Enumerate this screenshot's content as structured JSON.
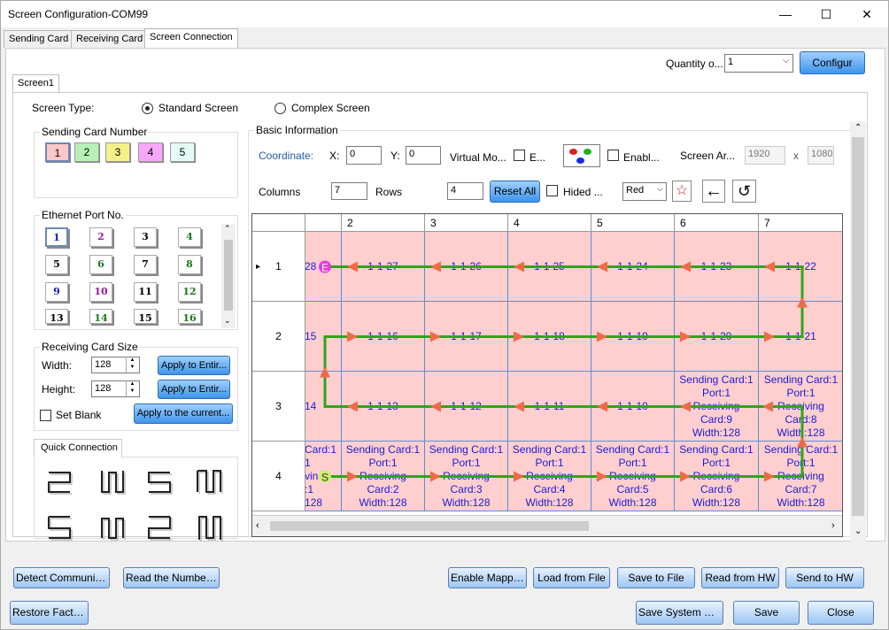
{
  "window": {
    "title": "Screen Configuration-COM99",
    "minimize": "—",
    "maximize": "☐",
    "close": "✕"
  },
  "tabs": [
    "Sending Card",
    "Receiving Card",
    "Screen Connection"
  ],
  "quantity": {
    "label": "Quantity o...",
    "value": "1",
    "configure": "Configur"
  },
  "screen_tab": "Screen1",
  "screen_type": {
    "label": "Screen Type:",
    "standard": "Standard Screen",
    "complex": "Complex Screen"
  },
  "sending_card_number": {
    "label": "Sending Card Number",
    "cards": [
      "1",
      "2",
      "3",
      "4",
      "5"
    ],
    "colors": [
      "#ffc8c8",
      "#b8f0b8",
      "#f6f08a",
      "#f8a8f8",
      "#e6fbf6"
    ]
  },
  "ethernet": {
    "label": "Ethernet Port No.",
    "ports": [
      "1",
      "2",
      "3",
      "4",
      "5",
      "6",
      "7",
      "8",
      "9",
      "10",
      "11",
      "12",
      "13",
      "14",
      "15",
      "16"
    ],
    "colors": [
      "#1a1ab8",
      "#9a1a9a",
      "#000000",
      "#1a7a1a",
      "#000000",
      "#1a7a1a",
      "#000000",
      "#1a7a1a",
      "#1a1ab8",
      "#9a1a9a",
      "#000000",
      "#1a7a1a",
      "#000000",
      "#1a7a1a",
      "#000000",
      "#1a7a1a"
    ]
  },
  "receiving_size": {
    "label": "Receiving Card Size",
    "width_label": "Width:",
    "width": "128",
    "height_label": "Height:",
    "height": "128",
    "apply_entire_w": "Apply to Entir...",
    "apply_entire_h": "Apply to Entir...",
    "set_blank": "Set Blank",
    "apply_current": "Apply to the current..."
  },
  "quick_connection": {
    "label": "Quick Connection"
  },
  "basic_info": {
    "label": "Basic Information",
    "coordinate": "Coordinate:",
    "x_label": "X:",
    "x": "0",
    "y_label": "Y:",
    "y": "0",
    "virtual_mode": "Virtual Mo...",
    "e_label": "E...",
    "enable_label": "Enabl...",
    "screen_area": "Screen Ar...",
    "area_w": "1920",
    "area_x": "x",
    "area_h": "1080",
    "columns_label": "Columns",
    "columns": "7",
    "rows_label": "Rows",
    "rows": "4",
    "reset_all": "Reset All",
    "hided": "Hided ...",
    "color": "Red"
  },
  "grid": {
    "col_headers": [
      "",
      "2",
      "3",
      "4",
      "5",
      "6",
      "7"
    ],
    "row_headers": [
      "1",
      "2",
      "3",
      "4"
    ],
    "rows": [
      [
        "28",
        "1-1-27",
        "1-1-26",
        "1-1-25",
        "1-1-24",
        "1-1-23",
        "1-1-22"
      ],
      [
        "15",
        "1-1-16",
        "1-1-17",
        "1-1-18",
        "1-1-19",
        "1-1-20",
        "1-1-21"
      ],
      [
        "14",
        "1-1-13",
        "1-1-12",
        "1-1-11",
        "1-1-10",
        "Sending Card:1\nPort:1\nReceiving\nCard:9\nWidth:128",
        "Sending Card:1\nPort:1\nReceiving\nCard:8\nWidth:128"
      ],
      [
        "Card:1\n1\nvin\n:1\n128",
        "Sending Card:1\nPort:1\nReceiving\nCard:2\nWidth:128",
        "Sending Card:1\nPort:1\nReceiving\nCard:3\nWidth:128",
        "Sending Card:1\nPort:1\nReceiving\nCard:4\nWidth:128",
        "Sending Card:1\nPort:1\nReceiving\nCard:5\nWidth:128",
        "Sending Card:1\nPort:1\nReceiving\nCard:6\nWidth:128",
        "Sending Card:1\nPort:1\nReceiving\nCard:7\nWidth:128"
      ]
    ],
    "start_marker": "S",
    "end_marker": "E"
  },
  "footer": {
    "detect": "Detect Communic...",
    "read_number": "Read the Number...",
    "enable_mapping": "Enable Mapping",
    "load_file": "Load from File",
    "save_file": "Save to File",
    "read_hw": "Read from HW",
    "send_hw": "Send to HW",
    "restore": "Restore Factor...",
    "save_system": "Save System Co...",
    "save": "Save",
    "close": "Close"
  }
}
